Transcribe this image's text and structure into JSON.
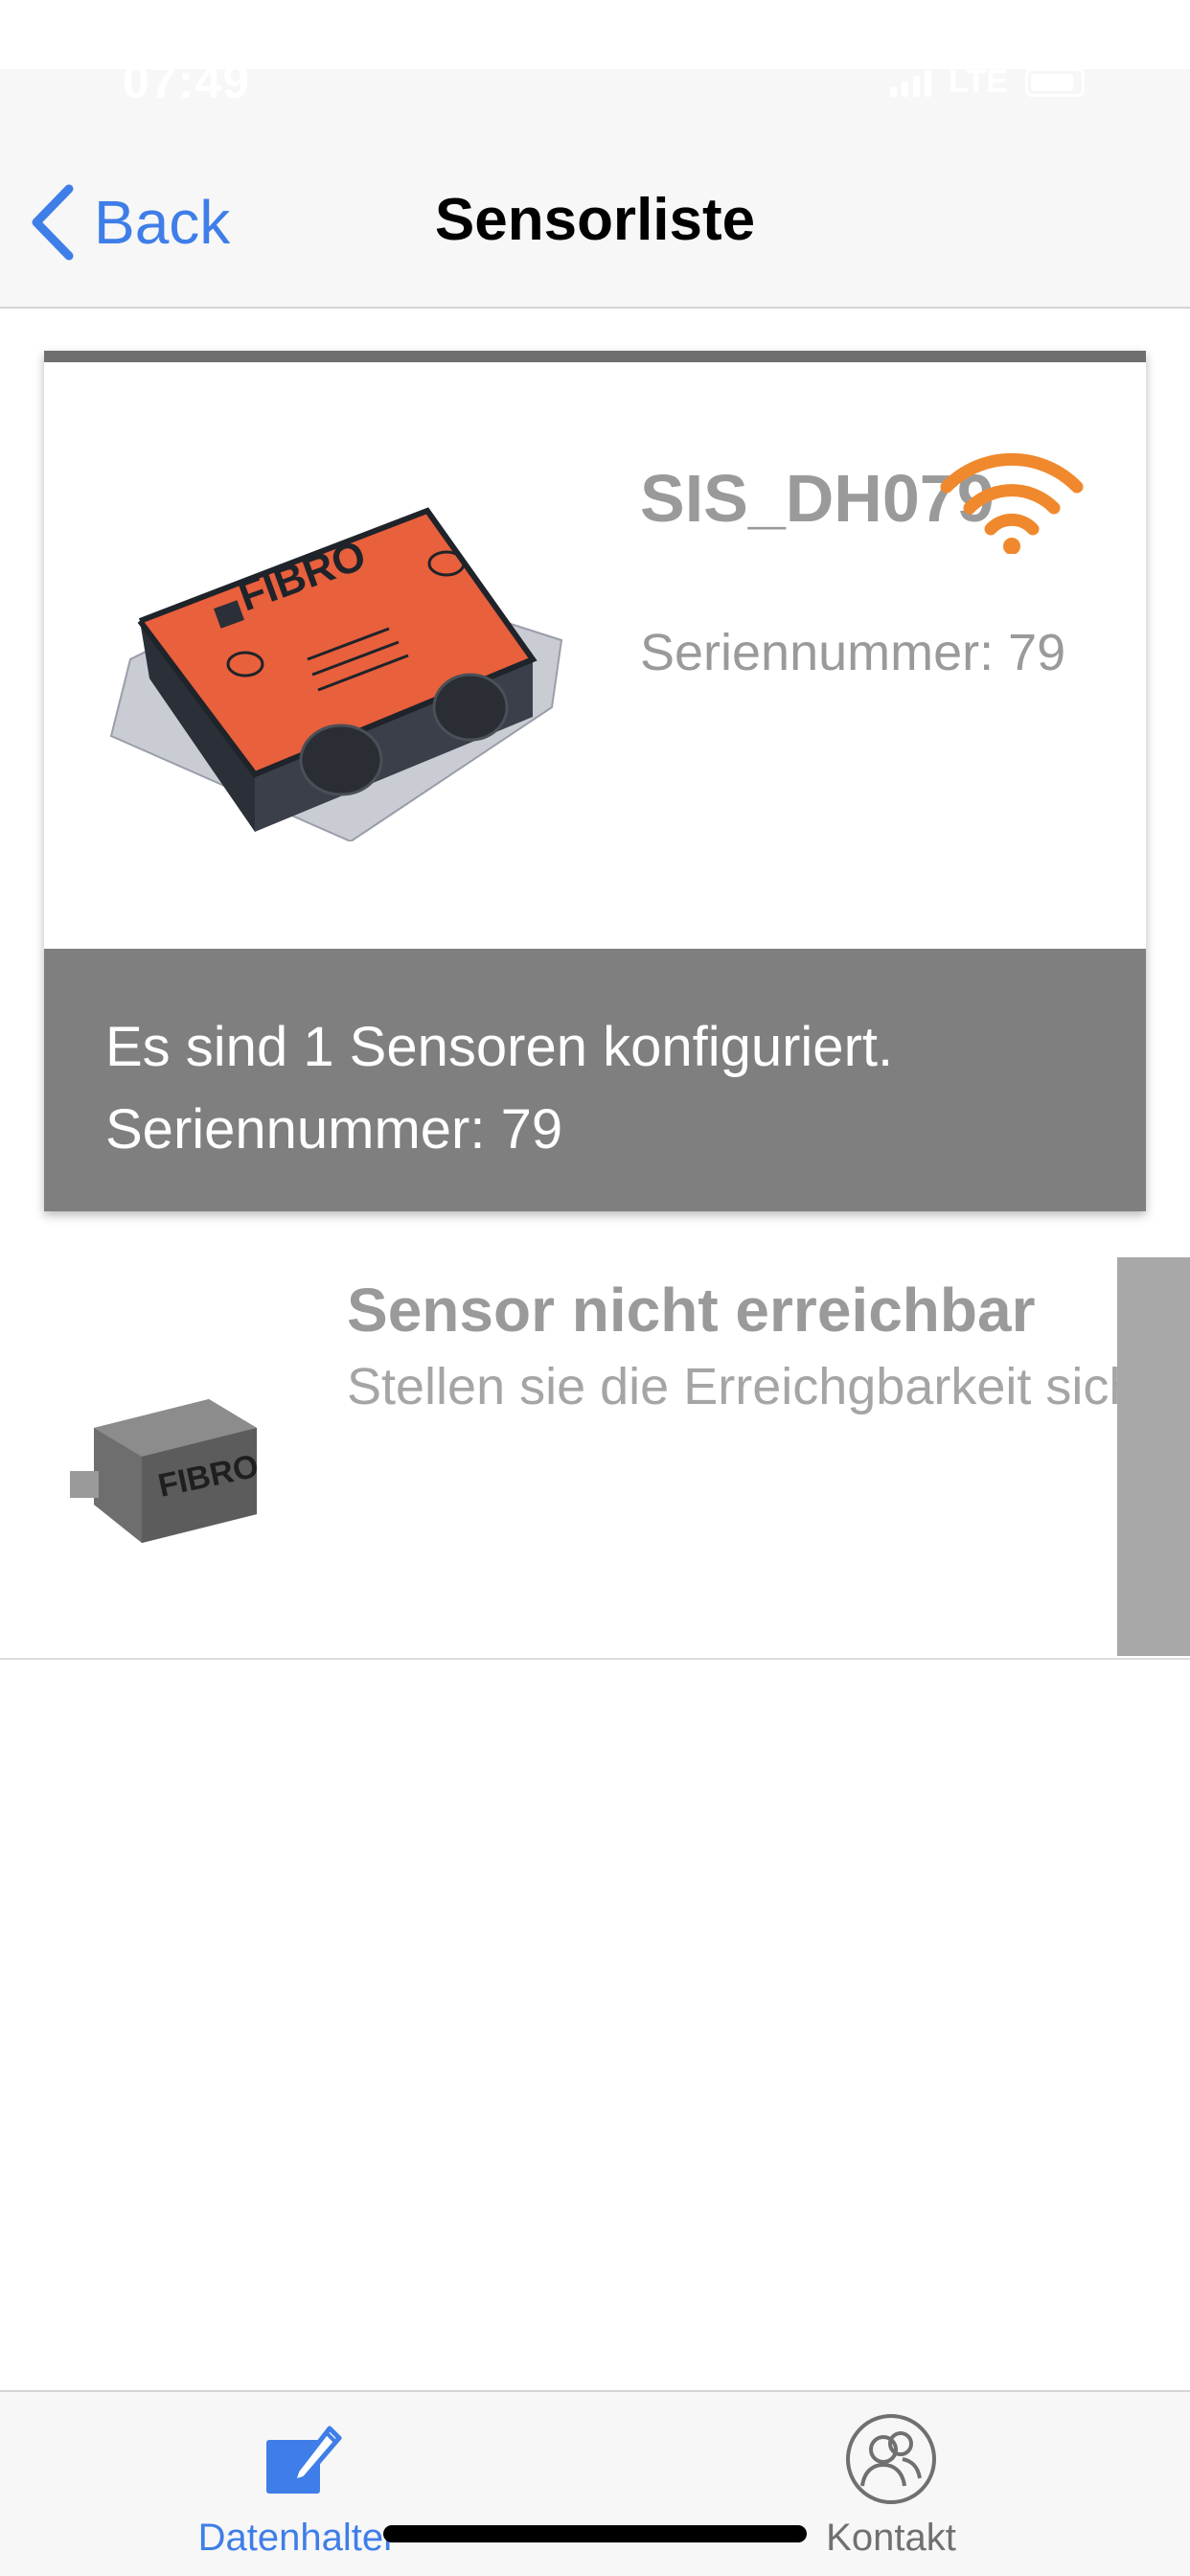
{
  "status_bar": {
    "time": "07:49",
    "network": "LTE"
  },
  "nav": {
    "back_label": "Back",
    "title": "Sensorliste"
  },
  "sensor_card": {
    "image_alt": "FIBRO sensor",
    "logo_text": "FIBRO",
    "title": "SIS_DH079",
    "serial": "Seriennummer: 79",
    "footer_line1": "Es sind 1 Sensoren konfiguriert.",
    "footer_line2": "Seriennummer: 79",
    "wifi_color": "#f0892d"
  },
  "unreachable": {
    "logo_text": "FIBRO",
    "title": "Sensor nicht erreichbar",
    "subtitle": "Stellen sie die Erreichgbarkeit sicher"
  },
  "tabs": [
    {
      "label": "Datenhalter",
      "icon": "edit-icon",
      "active": true,
      "color": "#3f7ee8"
    },
    {
      "label": "Kontakt",
      "icon": "contacts-icon",
      "active": false,
      "color": "#707070"
    }
  ],
  "colors": {
    "accent": "#3f7ee8",
    "footer_bg": "#7f7f7f",
    "sensor_orange": "#e8603c"
  }
}
